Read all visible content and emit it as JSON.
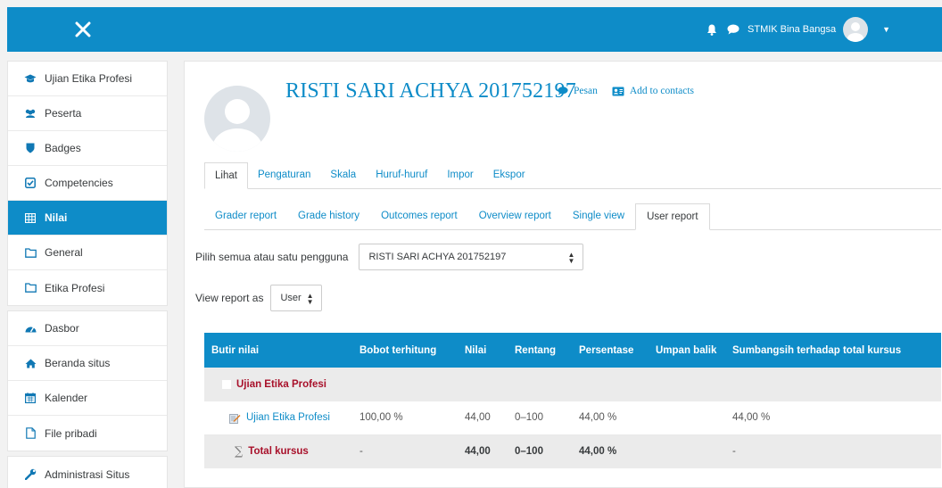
{
  "navbar": {
    "toggle_icon": "close-icon",
    "user_name": "STMIK Bina Bangsa",
    "brand_color": "#0e8cc8"
  },
  "sidebar": {
    "groups": [
      [
        {
          "label": "Ujian Etika Profesi",
          "icon": "graduation-cap-icon"
        },
        {
          "label": "Peserta",
          "icon": "users-icon"
        },
        {
          "label": "Badges",
          "icon": "shield-icon"
        },
        {
          "label": "Competencies",
          "icon": "check-square-icon"
        },
        {
          "label": "Nilai",
          "icon": "table-icon",
          "active": true
        },
        {
          "label": "General",
          "icon": "folder-icon"
        },
        {
          "label": "Etika Profesi",
          "icon": "folder-icon"
        }
      ],
      [
        {
          "label": "Dasbor",
          "icon": "dashboard-icon"
        },
        {
          "label": "Beranda situs",
          "icon": "home-icon"
        },
        {
          "label": "Kalender",
          "icon": "calendar-icon"
        },
        {
          "label": "File pribadi",
          "icon": "file-icon"
        }
      ],
      [
        {
          "label": "Administrasi Situs",
          "icon": "wrench-icon"
        }
      ]
    ]
  },
  "profile": {
    "name": "RISTI SARI ACHYA 201752197",
    "message_label": "Pesan",
    "contact_label": "Add to contacts"
  },
  "tabs_primary": [
    "Lihat",
    "Pengaturan",
    "Skala",
    "Huruf-huruf",
    "Impor",
    "Ekspor"
  ],
  "tabs_secondary": [
    "Grader report",
    "Grade history",
    "Outcomes report",
    "Overview report",
    "Single view",
    "User report"
  ],
  "user_select": {
    "label": "Pilih semua atau satu pengguna",
    "value": "RISTI SARI ACHYA 201752197"
  },
  "view_as": {
    "label": "View report as",
    "value": "User"
  },
  "grade_table": {
    "headers": [
      "Butir nilai",
      "Bobot terhitung",
      "Nilai",
      "Rentang",
      "Persentase",
      "Umpan balik",
      "Sumbangsih terhadap total kursus"
    ],
    "category": "Ujian Etika Profesi",
    "item": {
      "name": "Ujian Etika Profesi",
      "weight": "100,00 %",
      "grade": "44,00",
      "range": "0–100",
      "percentage": "44,00 %",
      "feedback": "",
      "contribution": "44,00 %"
    },
    "total": {
      "name": "Total kursus",
      "weight": "-",
      "grade": "44,00",
      "range": "0–100",
      "percentage": "44,00 %",
      "feedback": "",
      "contribution": "-"
    }
  }
}
